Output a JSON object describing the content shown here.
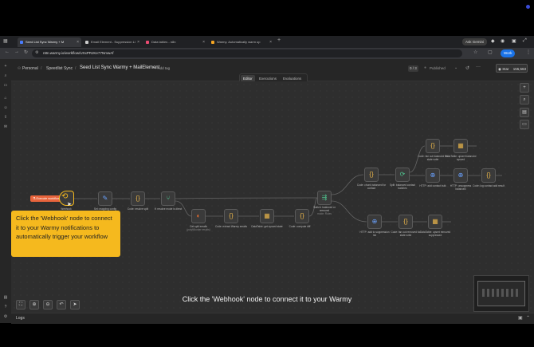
{
  "browser": {
    "tabs": [
      {
        "label": "Seed List Sync Warmy + M",
        "active": true,
        "color": "#4a7cff"
      },
      {
        "label": "Email Element - Suppression Li",
        "active": false,
        "color": "#cccccc"
      },
      {
        "label": "Data tables - n8n",
        "active": false,
        "color": "#ea4b71"
      },
      {
        "label": "Warmy. Automatically warm up",
        "active": false,
        "color": "#f5a623"
      }
    ],
    "ask_button": "Ask Gemini",
    "url": "n8n.warmy.io/workflow/UXxPRJKe77NmwAf",
    "profile_label": "Work"
  },
  "header": {
    "breadcrumb_owner": "Personal",
    "breadcrumb_project": "Speedlist Sync",
    "workflow_name": "Seed List Sync Warmy + MailElement",
    "add_tag": "+ Add tag",
    "counter": "0 / 3",
    "published": "Published",
    "star_label": "Star",
    "star_count": "155,563",
    "tabs": [
      "Editor",
      "Executions",
      "Evaluations"
    ]
  },
  "nodes": {
    "trigger_label": "Execute workflow",
    "webhook": "Webhook",
    "n1": "Set: mapping config",
    "n2": "Code: resolve split",
    "n3": "If: resolve mode is direct",
    "n4": "Get split emails",
    "n4b": "(polyfill/order results)",
    "n5": "Code: extract Warmy emails",
    "n6": "DataTable: get synced state",
    "n7": "Code: compute diff",
    "n8": "Switch: balanced or removed",
    "n8b": "mode: Rules",
    "n9": "Code: chunk balanced for contact",
    "n10": "Split: balanced contact batches",
    "n11": "HTTP: add contact bulk",
    "n12": "Code: fan out balanced for state write",
    "n13": "DataTable: upsert balanced synced",
    "n14": "HTTP: unsuppress balanced",
    "n15": "Code: log contact add result",
    "n16": "HTTP: add to suppression list",
    "n17": "Code: fan out removed for state write",
    "n18": "DataTable: upsert removed suppressed"
  },
  "tooltip": "Click the 'Webhook' node to connect it to your Warmy notifications to automatically trigger your workflow",
  "caption": "Click the 'Webhook' node to connect it to your Warmy",
  "logs_label": "Logs"
}
